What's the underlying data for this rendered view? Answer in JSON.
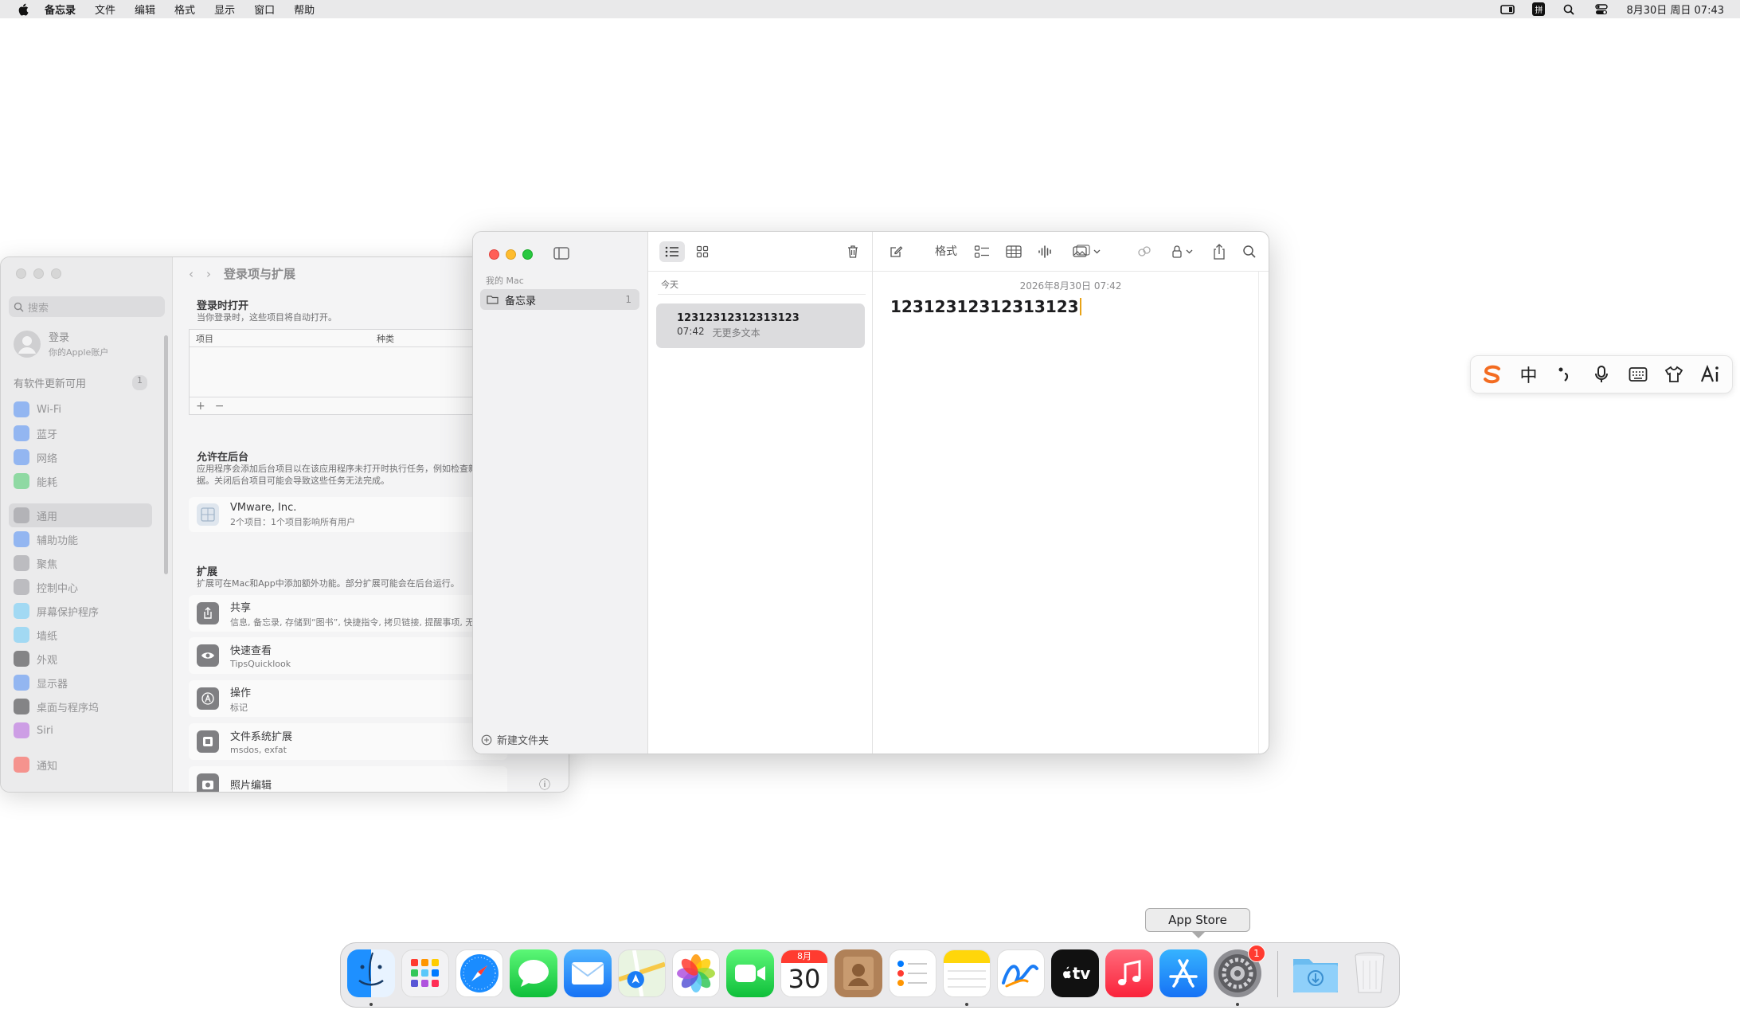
{
  "menubar": {
    "app_name": "备忘录",
    "items": [
      "文件",
      "编辑",
      "格式",
      "显示",
      "窗口",
      "帮助"
    ],
    "input_method": "拼",
    "datetime": "8月30日 周日 07:43"
  },
  "settings": {
    "search_placeholder": "搜索",
    "account": {
      "name": "登录",
      "subtitle": "你的Apple账户"
    },
    "update": {
      "label": "有软件更新可用",
      "count": "1"
    },
    "nav": [
      {
        "label": "Wi-Fi",
        "color": "#3b82f6"
      },
      {
        "label": "蓝牙",
        "color": "#3b82f6"
      },
      {
        "label": "网络",
        "color": "#3b82f6"
      },
      {
        "label": "能耗",
        "color": "#34c759"
      },
      {
        "label": "通用",
        "color": "#8e8e93"
      },
      {
        "label": "辅助功能",
        "color": "#3b82f6"
      },
      {
        "label": "聚焦",
        "color": "#8e8e93"
      },
      {
        "label": "控制中心",
        "color": "#8e8e93"
      },
      {
        "label": "屏幕保护程序",
        "color": "#5ac8fa"
      },
      {
        "label": "墙纸",
        "color": "#5ac8fa"
      },
      {
        "label": "外观",
        "color": "#1d1d1f"
      },
      {
        "label": "显示器",
        "color": "#3b82f6"
      },
      {
        "label": "桌面与程序坞",
        "color": "#1d1d1f"
      },
      {
        "label": "Siri",
        "color": "#af52de"
      },
      {
        "label": "通知",
        "color": "#ff3b30"
      }
    ],
    "page_title": "登录项与扩展",
    "open_at_login": {
      "title": "登录时打开",
      "desc": "当你登录时，这些项目将自动打开。",
      "columns": [
        "项目",
        "种类"
      ],
      "add": "+",
      "remove": "−"
    },
    "background": {
      "title": "允许在后台",
      "desc": "应用程序会添加后台项目以在该应用程序未打开时执行任务，例如检查新数据。关闭后台项目可能会导致这些任务无法完成。",
      "items": [
        {
          "name": "VMware, Inc.",
          "detail": "2个项目：1个项目影响所有用户"
        }
      ]
    },
    "extensions": {
      "title": "扩展",
      "desc": "扩展可在Mac和App中添加额外功能。部分扩展可能会在后台运行。",
      "items": [
        {
          "name": "共享",
          "detail": "信息, 备忘录, 存储到“图书”, 快捷指令, 拷贝链接, 提醒事项, 无"
        },
        {
          "name": "快速查看",
          "detail": "TipsQuicklook"
        },
        {
          "name": "操作",
          "detail": "标记"
        },
        {
          "name": "文件系统扩展",
          "detail": "msdos, exfat"
        },
        {
          "name": "照片编辑",
          "detail": ""
        }
      ]
    }
  },
  "notes": {
    "section_label": "我的 Mac",
    "folder": {
      "name": "备忘录",
      "count": "1"
    },
    "new_folder": "新建文件夹",
    "group_label": "今天",
    "note": {
      "title": "12312312312313123",
      "time": "07:42",
      "preview": "无更多文本"
    },
    "format_button": "格式",
    "date_line": "2026年8月30日 07:42",
    "body": "12312312312313123"
  },
  "ime": {
    "items": [
      "logo",
      "中",
      "punctuation",
      "mic",
      "keyboard",
      "skin",
      "ai"
    ]
  },
  "dock": {
    "tooltip": "App Store",
    "calendar_month": "8月",
    "calendar_day": "30",
    "system_settings_badge": "1",
    "tv_label": "tv",
    "apps": [
      "Finder",
      "Launchpad",
      "Safari",
      "Messages",
      "Mail",
      "Maps",
      "Photos",
      "FaceTime",
      "Calendar",
      "Contacts",
      "Reminders",
      "Notes",
      "Freeform",
      "TV",
      "Music",
      "App Store",
      "System Settings",
      "Downloads",
      "Trash"
    ]
  }
}
